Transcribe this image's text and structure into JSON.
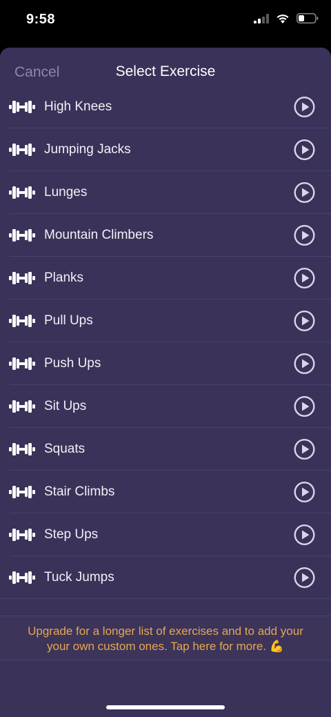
{
  "status_bar": {
    "time": "9:58",
    "icons": [
      "cellular-signal-icon",
      "wifi-icon",
      "battery-icon"
    ]
  },
  "header": {
    "cancel_label": "Cancel",
    "title": "Select Exercise"
  },
  "exercises": [
    {
      "name": "High Knees"
    },
    {
      "name": "Jumping Jacks"
    },
    {
      "name": "Lunges"
    },
    {
      "name": "Mountain Climbers"
    },
    {
      "name": "Planks"
    },
    {
      "name": "Pull Ups"
    },
    {
      "name": "Push Ups"
    },
    {
      "name": "Sit Ups"
    },
    {
      "name": "Squats"
    },
    {
      "name": "Stair Climbs"
    },
    {
      "name": "Step Ups"
    },
    {
      "name": "Tuck Jumps"
    }
  ],
  "upgrade_banner": {
    "line1": "Upgrade for a longer list of exercises and to add your",
    "line2": "your own custom ones.  Tap here for more. 💪"
  },
  "colors": {
    "sheet_background": "#3a3258",
    "accent_text": "#e8a653",
    "cancel_text": "#8e87ad",
    "separator": "#4a4369"
  }
}
